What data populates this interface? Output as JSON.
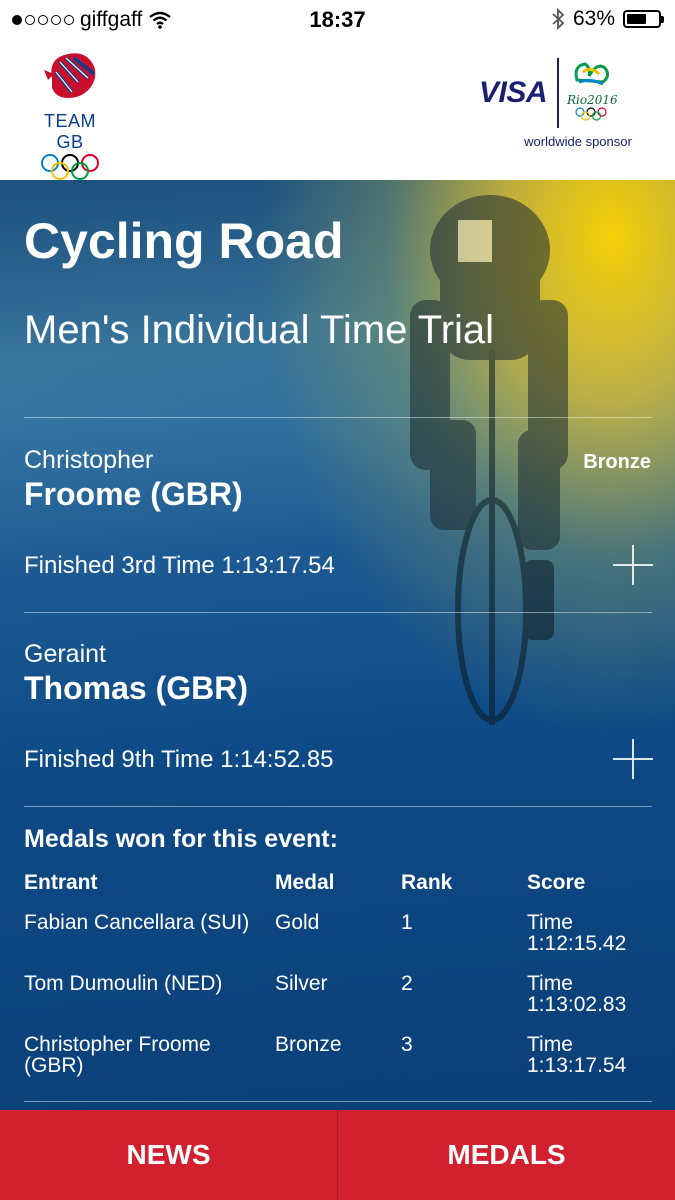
{
  "status_bar": {
    "carrier": "giffgaff",
    "time": "18:37",
    "battery": "63%",
    "battery_level": 0.63,
    "signal_filled": 1,
    "signal_total": 5
  },
  "header": {
    "team_label": "TEAM GB",
    "sponsor_brand": "VISA",
    "sponsor_event": "Rio2016",
    "sponsor_caption": "worldwide sponsor"
  },
  "event": {
    "sport": "Cycling Road",
    "discipline": "Men's Individual Time Trial"
  },
  "athletes": [
    {
      "first_name": "Christopher",
      "last_name": "Froome (GBR)",
      "medal": "Bronze",
      "result": "Finished 3rd Time 1:13:17.54"
    },
    {
      "first_name": "Geraint",
      "last_name": "Thomas (GBR)",
      "medal": "",
      "result": "Finished 9th Time 1:14:52.85"
    }
  ],
  "medals": {
    "heading": "Medals won for this event:",
    "columns": [
      "Entrant",
      "Medal",
      "Rank",
      "Score"
    ],
    "rows": [
      {
        "entrant": "Fabian Cancellara (SUI)",
        "medal": "Gold",
        "rank": "1",
        "score_label": "Time",
        "score_value": "1:12:15.42"
      },
      {
        "entrant": "Tom Dumoulin (NED)",
        "medal": "Silver",
        "rank": "2",
        "score_label": "Time",
        "score_value": "1:13:02.83"
      },
      {
        "entrant": "Christopher Froome (GBR)",
        "medal": "Bronze",
        "rank": "3",
        "score_label": "Time",
        "score_value": "1:13:17.54"
      }
    ]
  },
  "bottom_nav": {
    "news_label": "NEWS",
    "medals_label": "MEDALS"
  },
  "colors": {
    "nav_red": "#d3202f",
    "brand_blue": "#0a3d8f",
    "visa_blue": "#1a1f71",
    "hero_yellow": "#ffd600"
  }
}
